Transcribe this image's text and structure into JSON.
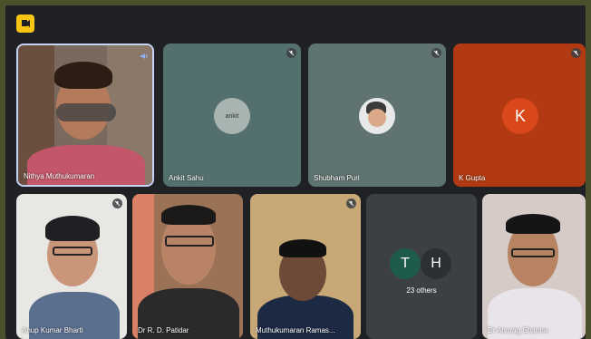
{
  "app": {
    "brand_color": "#f9c513"
  },
  "tiles": [
    {
      "name": "Nithya Muthukumaran",
      "speaking": true
    },
    {
      "name": "Ankit Sahu",
      "avatar_text": "ankit"
    },
    {
      "name": "Shubham Puri"
    },
    {
      "name": "K Gupta",
      "initial": "K"
    },
    {
      "name": "Anup Kumar Bharti"
    },
    {
      "name": "Dr R. D. Patidar"
    },
    {
      "name": "Muthukumaran Ramas..."
    },
    {
      "others": {
        "initials": [
          "T",
          "H"
        ],
        "label": "23 others"
      }
    },
    {
      "name": "Dr Anurag Sharma"
    }
  ],
  "colors": {
    "k_gupta_bg": "#c2410c",
    "k_avatar": "#d9481a",
    "t_avatar": "#1f5b4a",
    "h_avatar": "#3c4043"
  },
  "icons": [
    "meet-logo-icon",
    "mic-off-icon",
    "speaking-icon"
  ]
}
